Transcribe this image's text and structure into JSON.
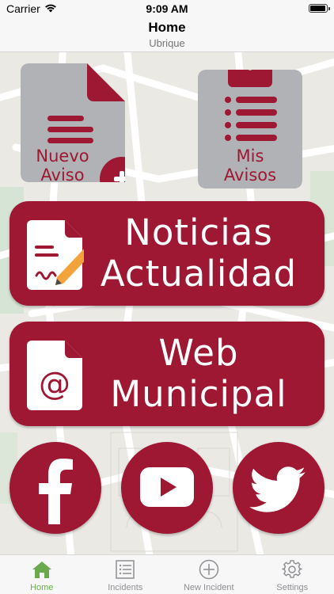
{
  "status_bar": {
    "carrier": "Carrier",
    "time": "9:09 AM"
  },
  "nav": {
    "title": "Home",
    "subtitle": "Ubrique"
  },
  "tiles": {
    "new_report": {
      "line1": "Nuevo",
      "line2": "Aviso",
      "icon": "document-plus-icon"
    },
    "my_reports": {
      "line1": "Mis",
      "line2": "Avisos",
      "icon": "clipboard-list-icon"
    }
  },
  "banners": {
    "news": {
      "line1": "Noticias",
      "line2": "Actualidad",
      "icon": "document-edit-icon"
    },
    "web": {
      "line1": "Web",
      "line2": "Municipal",
      "icon": "document-at-icon"
    }
  },
  "social": [
    "facebook-icon",
    "youtube-icon",
    "twitter-icon"
  ],
  "tabs": [
    {
      "label": "Home",
      "icon": "home-icon",
      "active": true
    },
    {
      "label": "Incidents",
      "icon": "list-icon",
      "active": false
    },
    {
      "label": "New Incident",
      "icon": "plus-circle-icon",
      "active": false
    },
    {
      "label": "Settings",
      "icon": "gear-icon",
      "active": false
    }
  ],
  "colors": {
    "brand": "#9e1733",
    "tile_grey": "#b0b2b5",
    "tab_active": "#6aa94d",
    "tab_inactive": "#8e8e93"
  }
}
